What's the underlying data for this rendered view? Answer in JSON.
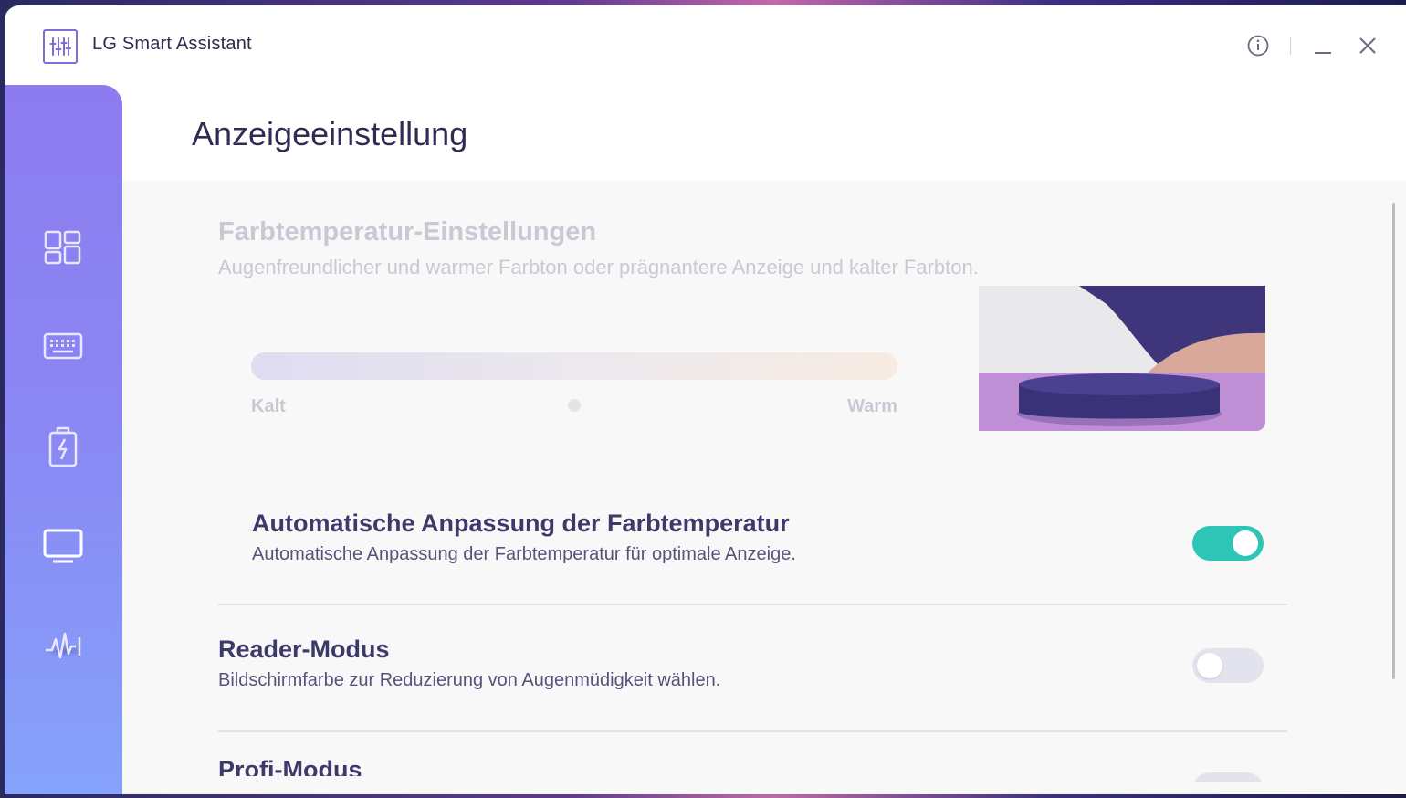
{
  "app": {
    "title": "LG Smart Assistant",
    "logo_icon": "equalizer-icon"
  },
  "titlebar": {
    "info_icon": "info-icon",
    "minimize_icon": "minimize-icon",
    "close_icon": "close-icon"
  },
  "sidebar": {
    "items": [
      {
        "icon": "dashboard-icon",
        "active": false
      },
      {
        "icon": "keyboard-icon",
        "active": false
      },
      {
        "icon": "battery-icon",
        "active": false
      },
      {
        "icon": "monitor-icon",
        "active": true
      },
      {
        "icon": "audio-wave-icon",
        "active": false
      }
    ]
  },
  "page": {
    "title": "Anzeigeeinstellung"
  },
  "color_temp": {
    "title": "Farbtemperatur-Einstellungen",
    "subtitle": "Augenfreundlicher und warmer Farbton oder prägnantere Anzeige und kalter Farbton.",
    "left_label": "Kalt",
    "right_label": "Warm",
    "disabled": true
  },
  "auto_temp": {
    "title": "Automatische Anpassung der Farbtemperatur",
    "description": "Automatische Anpassung der Farbtemperatur für optimale Anzeige.",
    "enabled": true
  },
  "reader_mode": {
    "title": "Reader-Modus",
    "description": "Bildschirmfarbe zur Reduzierung von Augenmüdigkeit wählen.",
    "enabled": false
  },
  "next_setting": {
    "title": "Profi-Modus"
  },
  "colors": {
    "accent_toggle_on": "#2ec4b6",
    "toggle_off": "#e3e3ee",
    "title_text": "#2e2c52",
    "sidebar_top": "#8d7cf0",
    "sidebar_bottom": "#86a2fb"
  }
}
